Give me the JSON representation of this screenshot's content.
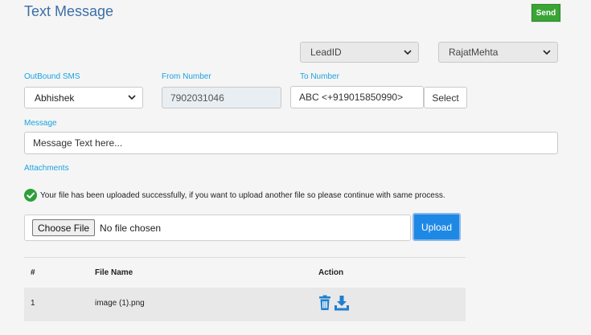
{
  "header": {
    "title": "Text Message",
    "send_label": "Send"
  },
  "top_selects": {
    "lead": "LeadID",
    "user": "RajatMehta"
  },
  "outbound": {
    "label": "OutBound SMS",
    "value": "Abhishek"
  },
  "from": {
    "label": "From Number",
    "value": "7902031046"
  },
  "to": {
    "label": "To Number",
    "value": "ABC <+919015850990>",
    "select_label": "Select"
  },
  "message": {
    "label": "Message",
    "placeholder": "Message Text here..."
  },
  "attachments": {
    "label": "Attachments",
    "success_text": "Your file has been uploaded successfully, if you want to upload another file so please continue with same process.",
    "choose_label": "Choose File",
    "no_file_text": "No file chosen",
    "upload_label": "Upload"
  },
  "table": {
    "headers": [
      "#",
      "File Name",
      "Action"
    ],
    "rows": [
      {
        "num": "1",
        "file": "image (1).png"
      }
    ]
  },
  "colors": {
    "accent": "#1e88e5",
    "success": "#3aa535",
    "label": "#1aa3e0",
    "title": "#3b6ea5"
  }
}
